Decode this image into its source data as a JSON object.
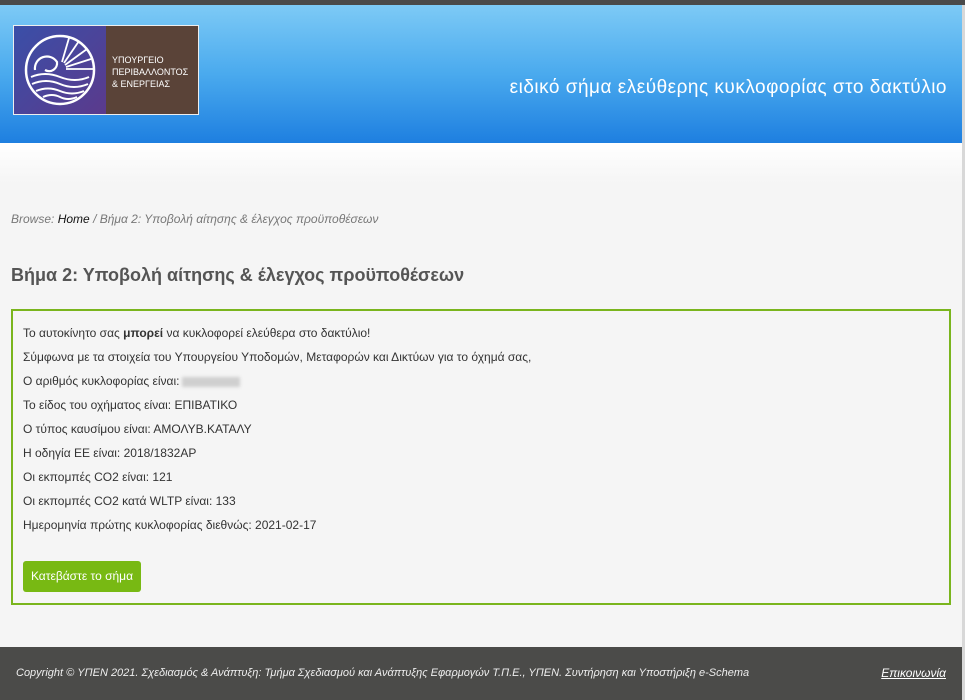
{
  "header": {
    "logo_lines": [
      "ΥΠΟΥΡΓΕΙΟ",
      "ΠΕΡΙΒΑΛΛΟΝΤΟΣ",
      "& ΕΝΕΡΓΕΙΑΣ"
    ],
    "site_title": "ειδικό σήμα ελεύθερης κυκλοφορίας στο δακτύλιο"
  },
  "breadcrumb": {
    "prefix": "Browse:",
    "home": "Home",
    "separator": "/",
    "current": "Βήμα 2: Υποβολή αίτησης & έλεγχος προϋποθέσεων"
  },
  "page_title": "Βήμα 2: Υποβολή αίτησης & έλεγχος προϋποθέσεων",
  "result": {
    "line1_pre": "Το αυτοκίνητο σας ",
    "line1_bold": "μπορεί",
    "line1_post": " να κυκλοφορεί ελεύθερα στο δακτύλιο!",
    "line2": "Σύμφωνα με τα στοιχεία του Υπουργείου Υποδομών, Μεταφορών και Δικτύων για το όχημά σας,",
    "plate_label": "Ο αριθμός κυκλοφορίας είναι:",
    "vehicle_type": "Το είδος του οχήματος είναι: ΕΠΙΒΑΤΙΚΟ",
    "fuel_type": "Ο τύπος καυσίμου είναι: ΑΜΟΛΥΒ.ΚΑΤΑΛΥ",
    "eu_directive": "Η οδηγία ΕΕ είναι: 2018/1832AP",
    "co2": "Οι εκπομπές CO2 είναι: 121",
    "co2_wltp": "Οι εκπομπές CO2 κατά WLTP είναι: 133",
    "first_registration": "Ημερομηνία πρώτης κυκλοφορίας διεθνώς: 2021-02-17",
    "download_label": "Κατεβάστε το σήμα"
  },
  "footer": {
    "copyright": "Copyright © ΥΠΕΝ 2021. Σχεδιασμός & Ανάπτυξη: Τμήμα Σχεδιασμού και Ανάπτυξης Εφαρμογών Τ.Π.Ε., ΥΠΕΝ. Συντήρηση και Υποστήριξη e-Schema",
    "contact": "Επικοινωνία"
  },
  "colors": {
    "header_top": "#7dcaf6",
    "header_bottom": "#1e7fe0",
    "accent_green": "#78b913",
    "footer_bg": "#4b4b49"
  }
}
